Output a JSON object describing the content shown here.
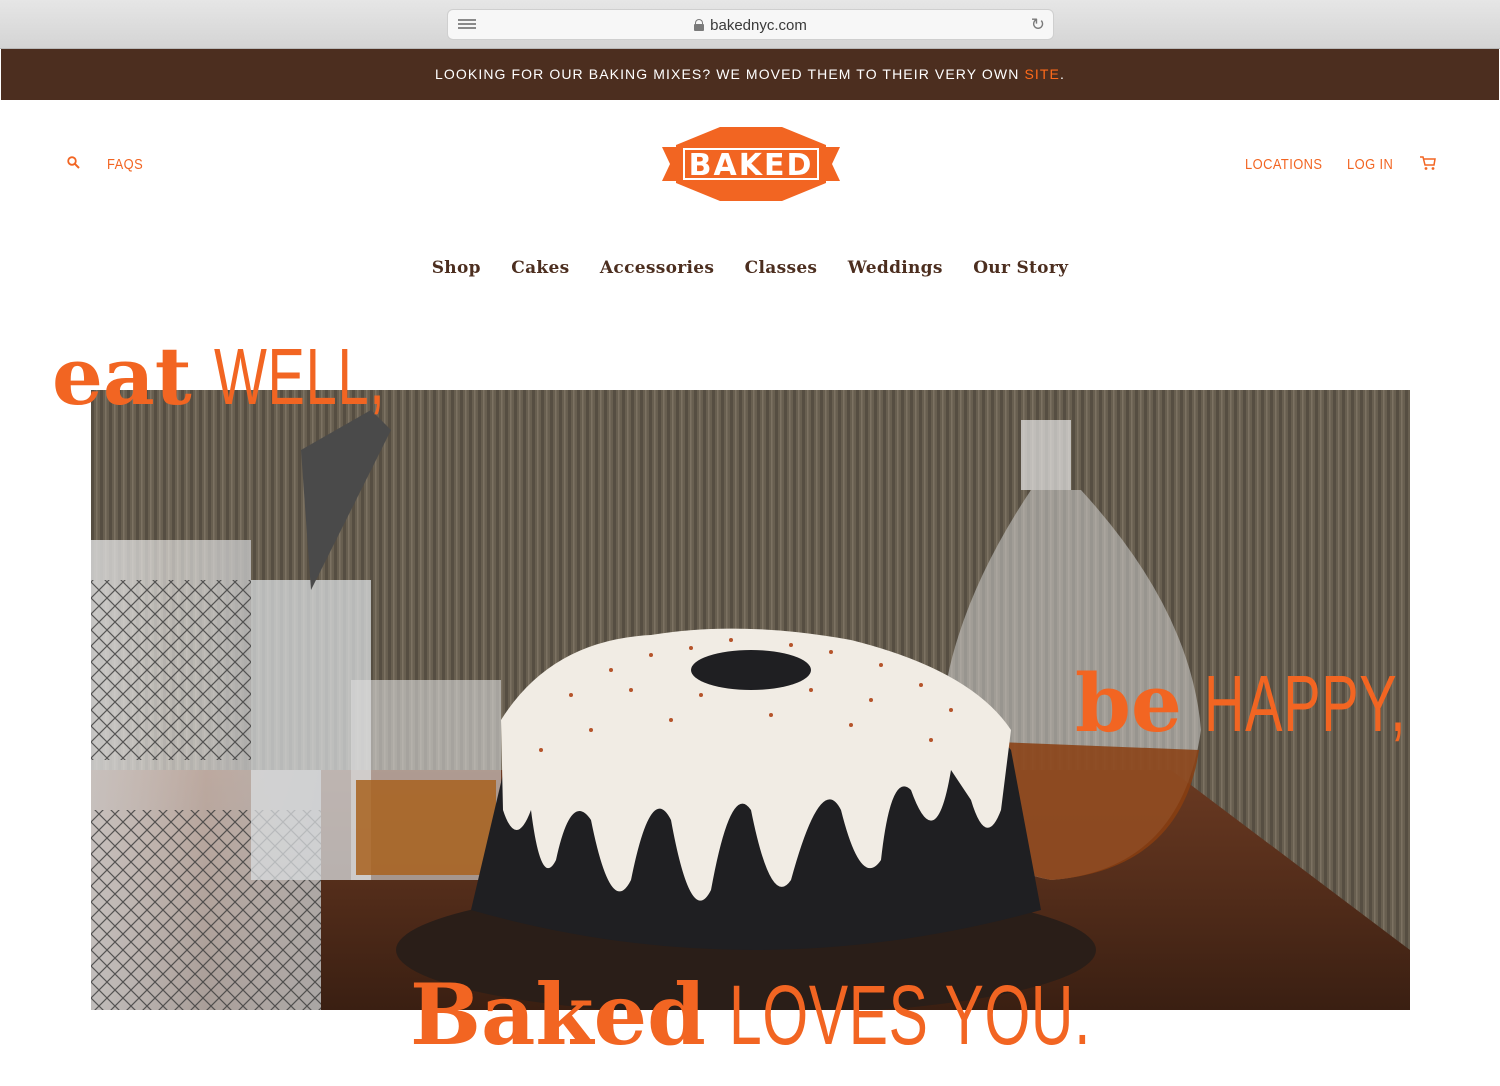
{
  "browser": {
    "url": "bakednyc.com",
    "reader_icon": "reader-icon",
    "lock_icon": "lock-icon",
    "reload_icon": "reload-icon"
  },
  "banner": {
    "text": "LOOKING FOR OUR BAKING MIXES? WE MOVED THEM TO THEIR VERY OWN ",
    "link_label": "SITE",
    "suffix": ".",
    "background": "#4c2e1f",
    "link_color": "#ff6a1a"
  },
  "header": {
    "search_icon": "search-icon",
    "faqs_label": "FAQS",
    "logo_text": "BAKED",
    "locations_label": "LOCATIONS",
    "login_label": "LOG IN",
    "cart_icon": "cart-icon",
    "accent_color": "#f26522"
  },
  "nav": {
    "items": [
      "Shop",
      "Cakes",
      "Accessories",
      "Classes",
      "Weddings",
      "Our Story"
    ],
    "color": "#4c2e1f"
  },
  "hero": {
    "line1_slab": "eat",
    "line1_narrow": "WELL,",
    "line2_slab": "be",
    "line2_narrow": "HAPPY,",
    "line3_slab": "Baked",
    "line3_narrow": "LOVES YOU.",
    "image_subject": "bundt-cake-with-glaze-photo"
  }
}
